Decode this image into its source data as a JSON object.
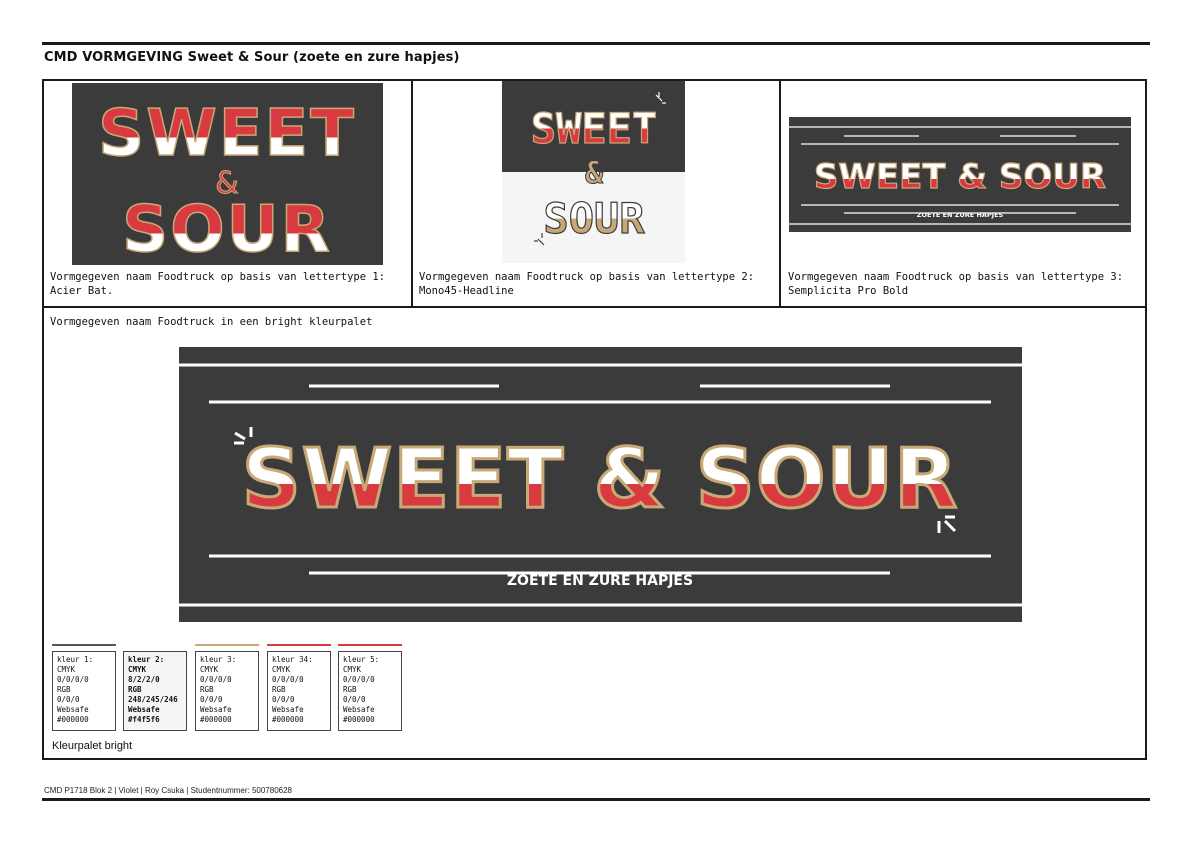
{
  "page_title": "CMD VORMGEVING Sweet & Sour (zoete en zure hapjes)",
  "panels": [
    {
      "caption_line1": "Vormgegeven naam Foodtruck op basis van lettertype 1:",
      "caption_line2": "Acier Bat."
    },
    {
      "caption_line1": "Vormgegeven naam Foodtruck op basis van lettertype 2:",
      "caption_line2": "Mono45-Headline"
    },
    {
      "caption_line1": "Vormgegeven naam Foodtruck op basis van lettertype 3:",
      "caption_line2": "Semplicita Pro Bold"
    }
  ],
  "bright_section": {
    "label": "Vormgegeven naam Foodtruck in een bright kleurpalet",
    "logo_text": "SWEET & SOUR",
    "tagline": "ZOETE EN ZURE HAPJES"
  },
  "logo1": {
    "line1": "SWEET",
    "line2": "&",
    "line3": "SOUR"
  },
  "logo2": {
    "line1": "SWEET",
    "line2": "&",
    "line3": "SOUR"
  },
  "logo3": {
    "text": "SWEET & SOUR",
    "tagline": "ZOETE EN ZURE HAPJES"
  },
  "colors": {
    "dark": "#3c3b3b",
    "red": "#d83a3f",
    "beige": "#c9a878",
    "white": "#ffffff",
    "light": "#f5f5f6"
  },
  "swatches": [
    {
      "title": "kleur 1:",
      "l2": "CMYK",
      "l3": "0/0/0/0",
      "l4": "RGB",
      "l5": "0/0/0",
      "l6": "Websafe",
      "l7": "#000000",
      "bar": "#555555",
      "bold": false
    },
    {
      "title": "kleur 2:",
      "l2": "CMYK",
      "l3": "8/2/2/0",
      "l4": "RGB",
      "l5": "248/245/246",
      "l6": "Websafe",
      "l7": "#f4f5f6",
      "bar": "#ffffff",
      "bold": true
    },
    {
      "title": "kleur 3:",
      "l2": "CMYK",
      "l3": "0/0/0/0",
      "l4": "RGB",
      "l5": "0/0/0",
      "l6": "Websafe",
      "l7": "#000000",
      "bar": "#c9a878",
      "bold": false
    },
    {
      "title": "kleur 34:",
      "l2": "CMYK",
      "l3": "0/0/0/0",
      "l4": "RGB",
      "l5": "0/0/0",
      "l6": "Websafe",
      "l7": "#000000",
      "bar": "#d83a3f",
      "bold": false
    },
    {
      "title": "kleur 5:",
      "l2": "CMYK",
      "l3": "0/0/0/0",
      "l4": "RGB",
      "l5": "0/0/0",
      "l6": "Websafe",
      "l7": "#000000",
      "bar": "#d83a3f",
      "bold": false
    }
  ],
  "palette_label": "Kleurpalet bright",
  "footer": "CMD P1718 Blok 2 | Violet | Roy Csuka | Studentnummer: 500780628"
}
